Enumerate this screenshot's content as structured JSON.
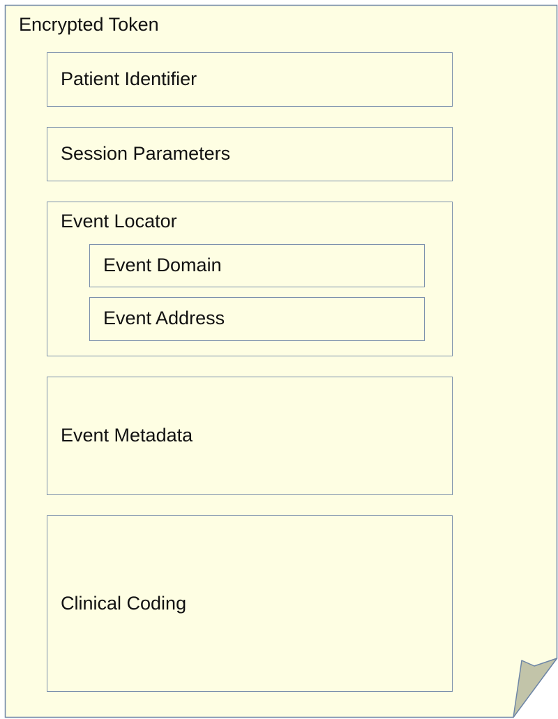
{
  "document": {
    "title": "Encrypted Token",
    "fill_color": "#fefee3",
    "border_color": "#6e86a6",
    "fold_color": "#c2c4a9"
  },
  "fields": {
    "patient_identifier": "Patient Identifier",
    "session_parameters": "Session Parameters",
    "event_locator": {
      "label": "Event Locator",
      "event_domain": "Event Domain",
      "event_address": "Event Address"
    },
    "event_metadata": "Event Metadata",
    "clinical_coding": "Clinical Coding"
  }
}
